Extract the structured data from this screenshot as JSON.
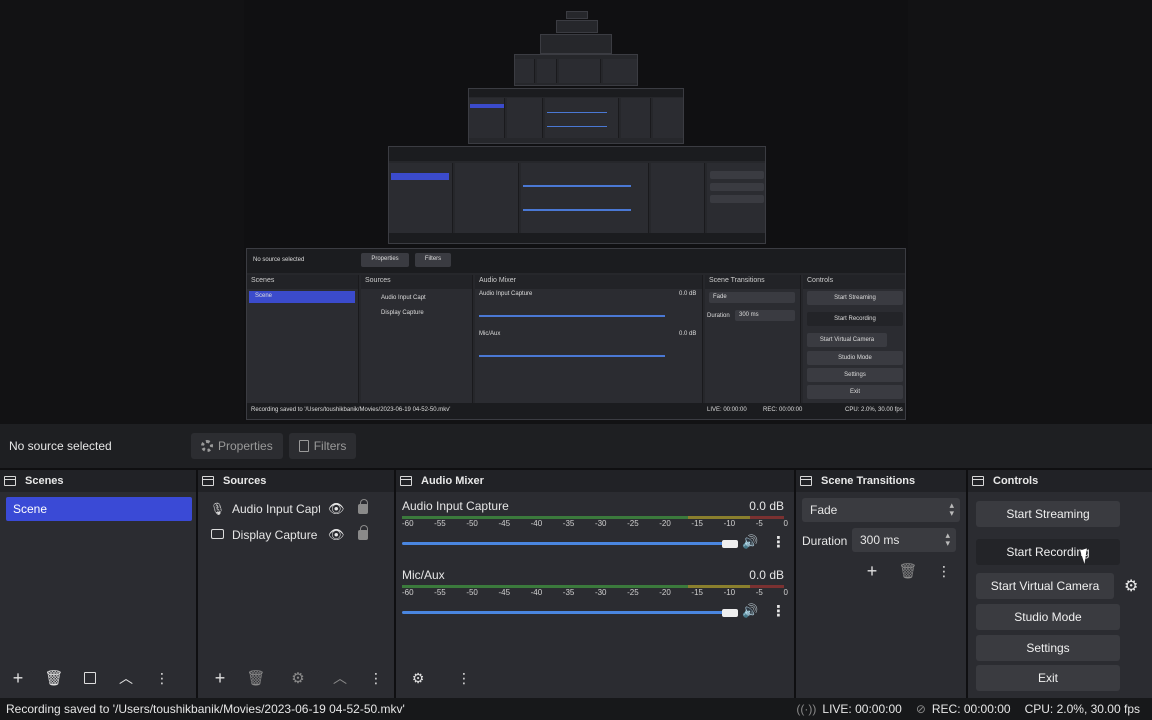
{
  "info_bar": {
    "no_source": "No source selected",
    "properties_label": "Properties",
    "filters_label": "Filters"
  },
  "scenes": {
    "title": "Scenes",
    "items": [
      "Scene"
    ]
  },
  "sources": {
    "title": "Sources",
    "items": [
      {
        "label": "Audio Input Capt",
        "icon": "microphone-icon"
      },
      {
        "label": "Display Capture",
        "icon": "monitor-icon"
      }
    ]
  },
  "audio_mixer": {
    "title": "Audio Mixer",
    "ticks": [
      "-60",
      "-55",
      "-50",
      "-45",
      "-40",
      "-35",
      "-30",
      "-25",
      "-20",
      "-15",
      "-10",
      "-5",
      "0"
    ],
    "channels": [
      {
        "name": "Audio Input Capture",
        "db": "0.0 dB",
        "volume": 1.0
      },
      {
        "name": "Mic/Aux",
        "db": "0.0 dB",
        "volume": 1.0
      }
    ]
  },
  "scene_transitions": {
    "title": "Scene Transitions",
    "transition": "Fade",
    "duration_label": "Duration",
    "duration_value": "300 ms"
  },
  "controls": {
    "title": "Controls",
    "start_streaming": "Start Streaming",
    "start_recording": "Start Recording",
    "start_virtual_camera": "Start Virtual Camera",
    "studio_mode": "Studio Mode",
    "settings": "Settings",
    "exit": "Exit"
  },
  "status_bar": {
    "message": "Recording saved to '/Users/toushikbanik/Movies/2023-06-19 04-52-50.mkv'",
    "live": "LIVE: 00:00:00",
    "rec": "REC: 00:00:00",
    "cpu": "CPU: 2.0%, 30.00 fps"
  },
  "preview": {
    "no_source": "No source selected",
    "properties_label": "Properties",
    "filters_label": "Filters",
    "scenes_title": "Scenes",
    "sources_title": "Sources",
    "mixer_title": "Audio Mixer",
    "transitions_title": "Scene Transitions",
    "controls_title": "Controls",
    "scene_item": "Scene",
    "source_1": "Audio Input Capt",
    "source_2": "Display Capture",
    "channel_1": "Audio Input Capture",
    "channel_2": "Mic/Aux",
    "db": "0.0 dB",
    "fade": "Fade",
    "duration": "Duration",
    "duration_value": "300 ms",
    "start_streaming": "Start Streaming",
    "start_recording": "Start Recording",
    "start_virtual_camera": "Start Virtual Camera",
    "studio_mode": "Studio Mode",
    "settings": "Settings",
    "exit": "Exit",
    "status_message": "Recording saved to '/Users/toushikbanik/Movies/2023-06-19 04-52-50.mkv'",
    "live": "LIVE: 00:00:00",
    "rec": "REC: 00:00:00",
    "cpu": "CPU: 2.0%, 30.00 fps"
  }
}
